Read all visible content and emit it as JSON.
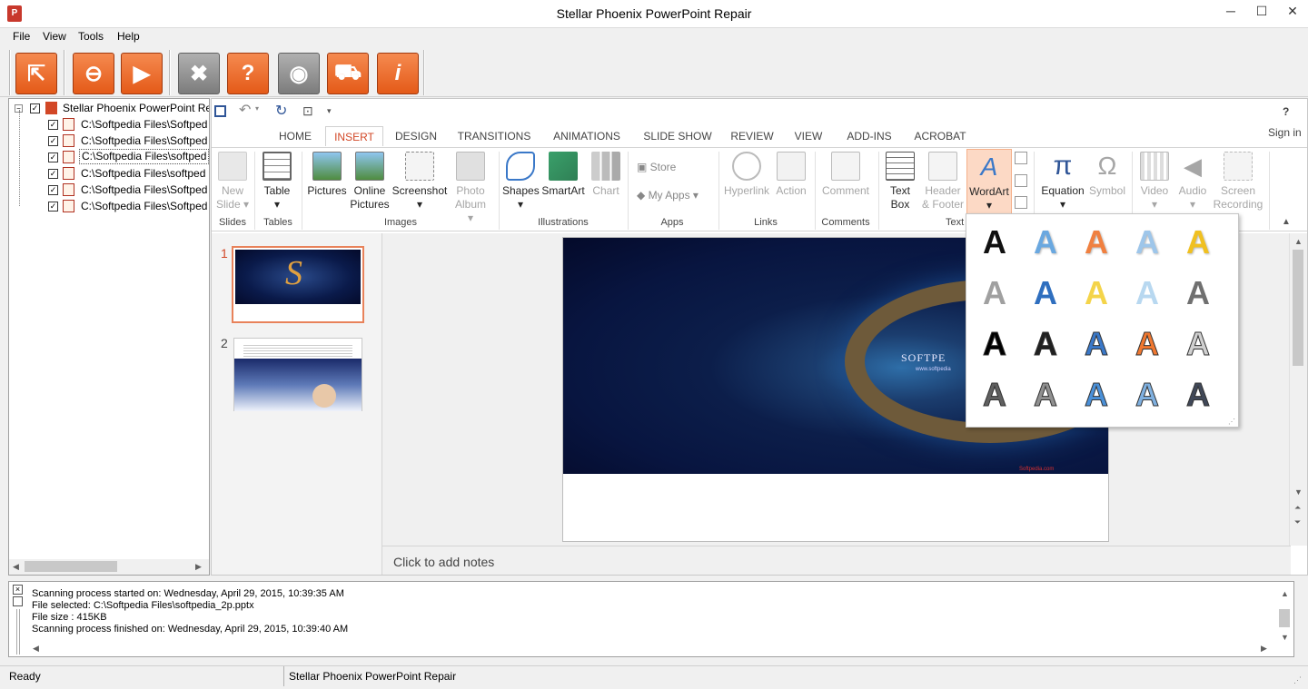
{
  "window": {
    "title": "Stellar Phoenix PowerPoint Repair",
    "app_badge": "P"
  },
  "menu": [
    "File",
    "View",
    "Tools",
    "Help"
  ],
  "toolbar": [
    {
      "name": "open-file",
      "glyph": "⇱"
    },
    {
      "name": "search",
      "glyph": "⊖"
    },
    {
      "name": "start-repair",
      "glyph": "▶"
    },
    {
      "name": "stop",
      "glyph": "✖"
    },
    {
      "name": "help",
      "glyph": "?"
    },
    {
      "name": "web",
      "glyph": "◉"
    },
    {
      "name": "buy",
      "glyph": "⛟"
    },
    {
      "name": "about",
      "glyph": "i"
    }
  ],
  "tree": {
    "root": "Stellar Phoenix PowerPoint Re",
    "items": [
      "C:\\Softpedia Files\\Softped",
      "C:\\Softpedia Files\\Softped",
      "C:\\Softpedia Files\\softped",
      "C:\\Softpedia Files\\softped",
      "C:\\Softpedia Files\\Softped",
      "C:\\Softpedia Files\\Softped"
    ]
  },
  "ppt": {
    "help": "?",
    "sign_in": "Sign in",
    "tabs": [
      "HOME",
      "INSERT",
      "DESIGN",
      "TRANSITIONS",
      "ANIMATIONS",
      "SLIDE SHOW",
      "REVIEW",
      "VIEW",
      "ADD-INS",
      "ACROBAT"
    ],
    "active_tab": "INSERT",
    "ribbon": {
      "new_slide": [
        "New",
        "Slide ▾"
      ],
      "table": [
        "Table",
        "▾"
      ],
      "pictures": "Pictures",
      "online_pictures": [
        "Online",
        "Pictures"
      ],
      "screenshot": [
        "Screenshot",
        "▾"
      ],
      "photo_album": [
        "Photo",
        "Album ▾"
      ],
      "shapes": [
        "Shapes",
        "▾"
      ],
      "smartart": "SmartArt",
      "chart": "Chart",
      "store": "Store",
      "my_apps": "My Apps",
      "hyperlink": "Hyperlink",
      "action": "Action",
      "comment": "Comment",
      "text_box": [
        "Text",
        "Box"
      ],
      "header_footer": [
        "Header",
        "& Footer"
      ],
      "wordart": [
        "WordArt",
        "▾"
      ],
      "equation": [
        "Equation",
        "▾"
      ],
      "symbol": "Symbol",
      "video": [
        "Video",
        "▾"
      ],
      "audio": [
        "Audio",
        "▾"
      ],
      "screen_recording": [
        "Screen",
        "Recording"
      ],
      "groups": [
        "Slides",
        "Tables",
        "Images",
        "Illustrations",
        "Apps",
        "Links",
        "Comments",
        "Text"
      ]
    },
    "slides": [
      {
        "num": "1"
      },
      {
        "num": "2"
      }
    ],
    "slide_text": "SOFTPE",
    "slide_url": "www.softpedia",
    "slide_footer": "Softpedia.com",
    "notes_placeholder": "Click to add notes"
  },
  "wordart_gallery": {
    "glyph": "A",
    "styles": [
      [
        "#111111",
        "#6aa8e0",
        "#f08040",
        "#9ec6ea",
        "#f0c020"
      ],
      [
        "#a0a0a0",
        "#2f6fbf",
        "#f4d44a",
        "#b8d8f0",
        "#707070"
      ],
      [
        "#000000",
        "#202020",
        "#3a78c8",
        "#f07830",
        "#d0d0d0"
      ],
      [
        "#606060",
        "#909090",
        "#4a90d8",
        "#7fb0e0",
        "#404858"
      ]
    ]
  },
  "log": [
    "Scanning process started on: Wednesday, April 29, 2015, 10:39:35 AM",
    "File selected: C:\\Softpedia Files\\softpedia_2p.pptx",
    "File size : 415KB",
    "Scanning process finished on: Wednesday, April 29, 2015, 10:39:40 AM"
  ],
  "status": {
    "left": "Ready",
    "right": "Stellar Phoenix PowerPoint Repair"
  },
  "colors": {
    "accent_orange": "#d24726",
    "toolbar_orange": "#e45a18",
    "wordart_highlight": "#fcd9c5"
  }
}
